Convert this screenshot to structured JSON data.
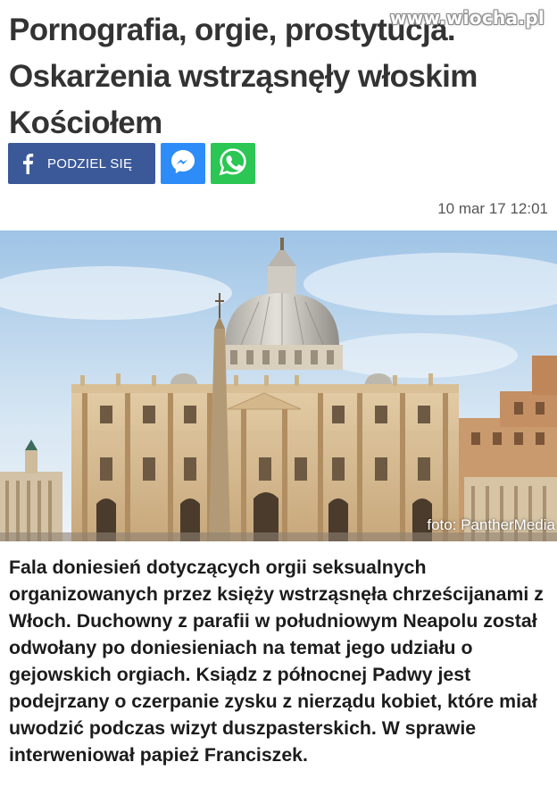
{
  "watermark": "www.wiocha.pl",
  "headline": "Pornografia, orgie, prostytucja. Oskarżenia wstrząsnęły włoskim Kościołem",
  "share": {
    "facebook_label": "PODZIEL SIĘ",
    "facebook_icon": "facebook-f-icon",
    "messenger_icon": "messenger-icon",
    "whatsapp_icon": "whatsapp-icon",
    "colors": {
      "facebook": "#3b5998",
      "messenger": "#2d8cf7",
      "whatsapp": "#2bc653"
    }
  },
  "timestamp": "10 mar 17 12:01",
  "photo": {
    "credit": "foto: PantherMedia"
  },
  "article_text": "Fala doniesień dotyczących orgii seksualnych organizowanych przez księży wstrząsnęła chrześcijanami z Włoch. Duchowny z parafii w południowym Neapolu został odwołany po doniesieniach na temat jego udziału o gejowskich orgiach. Ksiądz z północnej Padwy jest podejrzany o czerpanie zysku z nierządu kobiet, które miał uwodzić podczas wizyt duszpasterskich. W sprawie interweniował papież Franciszek."
}
